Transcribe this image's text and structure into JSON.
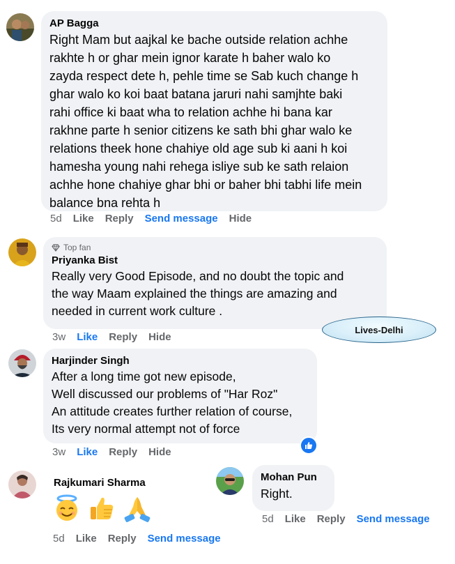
{
  "comments": [
    {
      "author": "AP Bagga",
      "text": "Right Mam but aajkal ke bache outside relation achhe\nrakhte h or ghar mein ignor karate h baher walo ko\nzayda respect dete h, pehle time se Sab kuch change h\nghar walo ko koi baat batana jaruri nahi samjhte baki\nrahi office ki baat wha to relation achhe hi bana kar\nrakhne parte h senior citizens ke sath bhi ghar walo ke\nrelations theek hone chahiye old age sub ki aani h koi\nhamesha young nahi rehega isliye sub ke sath relaion\nachhe hone chahiye ghar bhi or baher bhi tabhi life mein\nbalance bna rehta h",
      "time": "5d",
      "actions": [
        "Like",
        "Reply",
        "Send message",
        "Hide"
      ]
    },
    {
      "badge": "Top fan",
      "author": "Priyanka Bist",
      "text": "Really very Good Episode, and no doubt the topic and\nthe way Maam explained the things are amazing and\nneeded in current work culture .",
      "time": "3w",
      "actions": [
        "Like",
        "Reply",
        "Hide"
      ]
    },
    {
      "author": "Harjinder Singh",
      "text": "After a long time got new episode,\nWell discussed our problems of \"Har Roz\"\nAn attitude creates further relation of course,\nIts very normal attempt not of force",
      "time": "3w",
      "actions": [
        "Like",
        "Reply",
        "Hide"
      ]
    },
    {
      "author": "Rajkumari Sharma",
      "emojis": [
        "smiling-face-with-halo",
        "thumbs-up",
        "folded-hands"
      ],
      "time": "5d",
      "actions": [
        "Like",
        "Reply",
        "Send message"
      ]
    },
    {
      "author": "Mohan Pun",
      "text": "Right.",
      "time": "5d",
      "actions": [
        "Like",
        "Reply",
        "Send message"
      ]
    }
  ],
  "overlay_label": "Lives-Delhi",
  "colors": {
    "bubble": "#f0f2f5",
    "meta": "#65676b",
    "accent": "#1877f2"
  }
}
